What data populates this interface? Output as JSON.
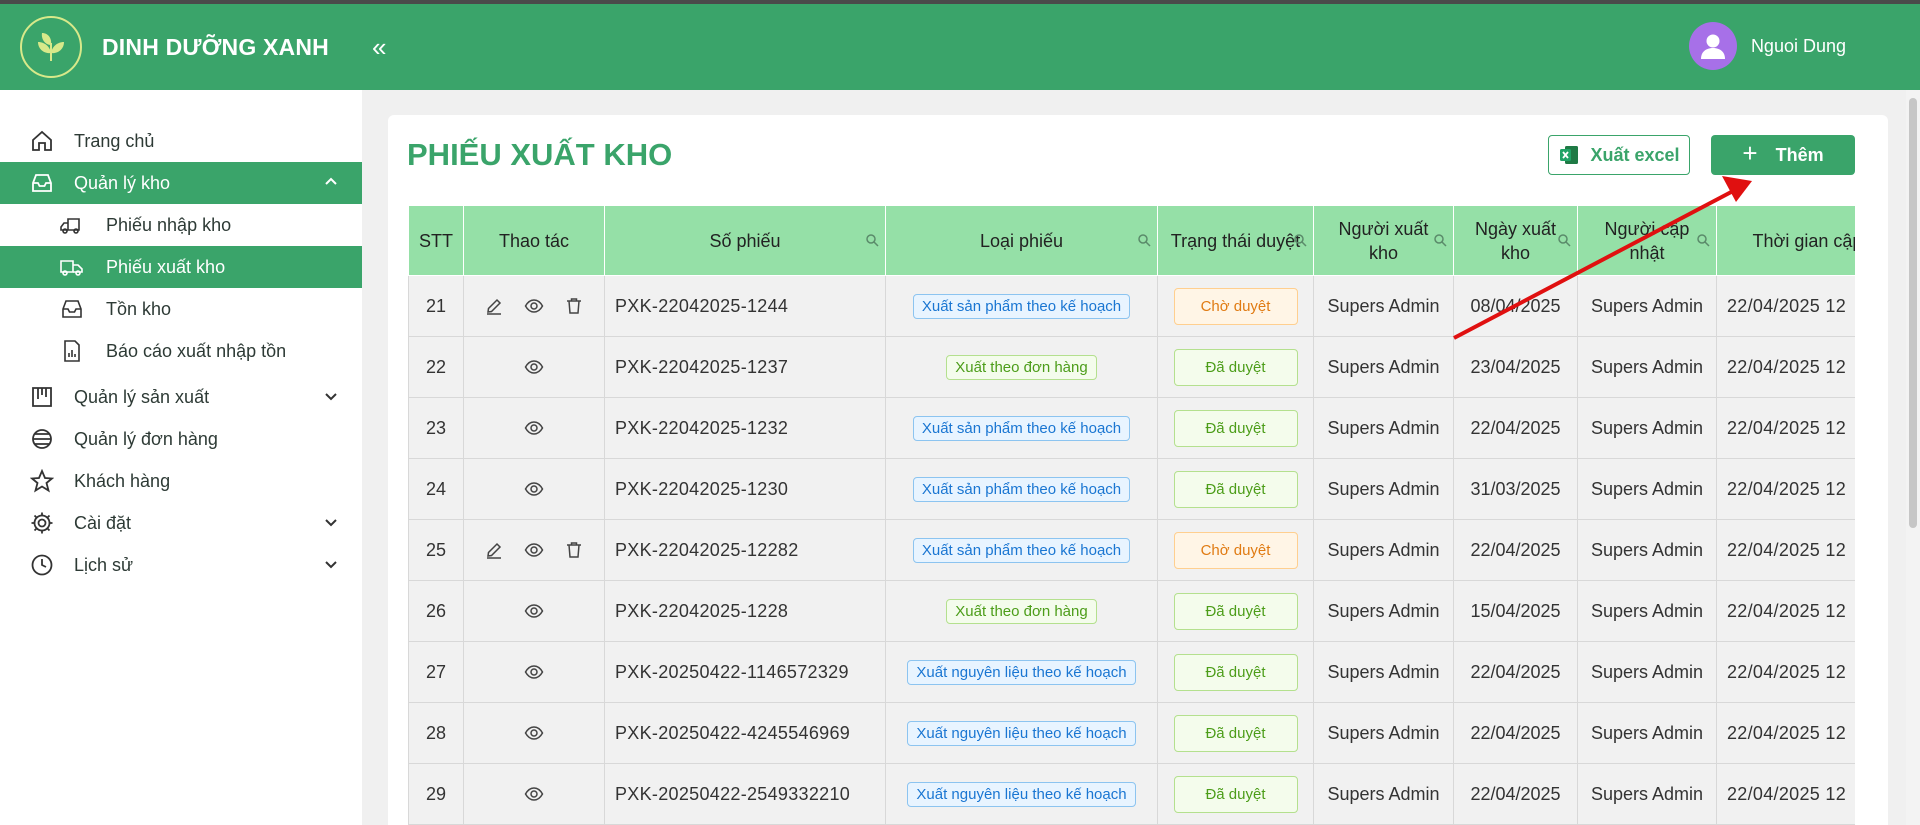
{
  "brand": {
    "name": "DINH DƯỠNG XANH"
  },
  "user": {
    "name": "Nguoi Dung"
  },
  "sidebar": {
    "items": [
      {
        "label": "Trang chủ"
      },
      {
        "label": "Quản lý kho",
        "subitems": [
          {
            "label": "Phiếu nhập kho"
          },
          {
            "label": "Phiếu xuất kho"
          },
          {
            "label": "Tồn kho"
          },
          {
            "label": "Báo cáo xuất nhập tồn"
          }
        ]
      },
      {
        "label": "Quản lý sản xuất"
      },
      {
        "label": "Quản lý đơn hàng"
      },
      {
        "label": "Khách hàng"
      },
      {
        "label": "Cài đặt"
      },
      {
        "label": "Lịch sử"
      }
    ]
  },
  "page": {
    "title": "PHIẾU XUẤT KHO",
    "excel_label": "Xuất excel",
    "add_label": "Thêm"
  },
  "table": {
    "headers": {
      "stt": "STT",
      "actions": "Thao tác",
      "code": "Số phiếu",
      "type": "Loại phiếu",
      "status": "Trạng thái duyệt",
      "exporter": "Người xuất kho",
      "date": "Ngày xuất kho",
      "updater": "Người cập nhật",
      "updated_at": "Thời gian cập nhật"
    },
    "rows": [
      {
        "stt": "21",
        "code": "PXK-22042025-1244",
        "type": "Xuất sản phẩm theo kế hoạch",
        "status": "Chờ duyệt",
        "exporter": "Supers Admin",
        "date": "08/04/2025",
        "updater": "Supers Admin",
        "updated_at": "22/04/2025 12"
      },
      {
        "stt": "22",
        "code": "PXK-22042025-1237",
        "type": "Xuất theo đơn hàng",
        "status": "Đã duyệt",
        "exporter": "Supers Admin",
        "date": "23/04/2025",
        "updater": "Supers Admin",
        "updated_at": "22/04/2025 12"
      },
      {
        "stt": "23",
        "code": "PXK-22042025-1232",
        "type": "Xuất sản phẩm theo kế hoạch",
        "status": "Đã duyệt",
        "exporter": "Supers Admin",
        "date": "22/04/2025",
        "updater": "Supers Admin",
        "updated_at": "22/04/2025 12"
      },
      {
        "stt": "24",
        "code": "PXK-22042025-1230",
        "type": "Xuất sản phẩm theo kế hoạch",
        "status": "Đã duyệt",
        "exporter": "Supers Admin",
        "date": "31/03/2025",
        "updater": "Supers Admin",
        "updated_at": "22/04/2025 12"
      },
      {
        "stt": "25",
        "code": "PXK-22042025-12282",
        "type": "Xuất sản phẩm theo kế hoạch",
        "status": "Chờ duyệt",
        "exporter": "Supers Admin",
        "date": "22/04/2025",
        "updater": "Supers Admin",
        "updated_at": "22/04/2025 12"
      },
      {
        "stt": "26",
        "code": "PXK-22042025-1228",
        "type": "Xuất theo đơn hàng",
        "status": "Đã duyệt",
        "exporter": "Supers Admin",
        "date": "15/04/2025",
        "updater": "Supers Admin",
        "updated_at": "22/04/2025 12"
      },
      {
        "stt": "27",
        "code": "PXK-20250422-1146572329",
        "type": "Xuất nguyên liệu theo kế hoạch",
        "status": "Đã duyệt",
        "exporter": "Supers Admin",
        "date": "22/04/2025",
        "updater": "Supers Admin",
        "updated_at": "22/04/2025 12"
      },
      {
        "stt": "28",
        "code": "PXK-20250422-4245546969",
        "type": "Xuất nguyên liệu theo kế hoạch",
        "status": "Đã duyệt",
        "exporter": "Supers Admin",
        "date": "22/04/2025",
        "updater": "Supers Admin",
        "updated_at": "22/04/2025 12"
      },
      {
        "stt": "29",
        "code": "PXK-20250422-2549332210",
        "type": "Xuất nguyên liệu theo kế hoạch",
        "status": "Đã duyệt",
        "exporter": "Supers Admin",
        "date": "22/04/2025",
        "updater": "Supers Admin",
        "updated_at": "22/04/2025 12"
      }
    ]
  },
  "colors": {
    "brand_green": "#3aa46a",
    "header_row": "#95e0a7",
    "pending": "#e07b13",
    "approved": "#4c9d19",
    "tag_blue": "#1a76d2",
    "avatar": "#a770e8",
    "annotation_arrow": "#e01010"
  },
  "icons": {
    "logo": "leaf-logo-icon",
    "collapse": "double-chevron-left-icon",
    "edit": "pencil-icon",
    "view": "eye-icon",
    "delete": "trash-icon",
    "search": "search-icon",
    "excel": "excel-icon"
  }
}
